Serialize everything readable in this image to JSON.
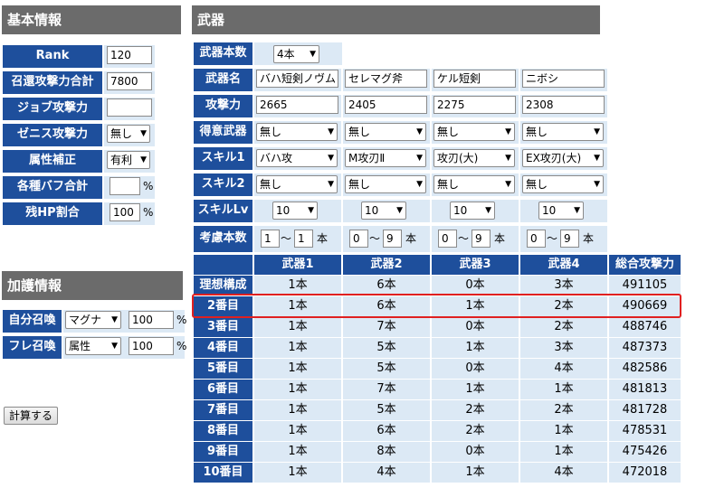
{
  "basic": {
    "header": "基本情報",
    "rows": [
      {
        "label": "Rank",
        "type": "input",
        "value": "120"
      },
      {
        "label": "召還攻撃力合計",
        "type": "input",
        "value": "7800"
      },
      {
        "label": "ジョブ攻撃力",
        "type": "input",
        "value": ""
      },
      {
        "label": "ゼニス攻撃力",
        "type": "select",
        "value": "無し"
      },
      {
        "label": "属性補正",
        "type": "select",
        "value": "有利"
      },
      {
        "label": "各種バフ合計",
        "type": "input_unit",
        "value": "",
        "unit": "%"
      },
      {
        "label": "残HP割合",
        "type": "input_unit",
        "value": "100",
        "unit": "%"
      }
    ]
  },
  "kago": {
    "header": "加護情報",
    "rows": [
      {
        "label": "自分召喚",
        "select": "マグナ",
        "value": "100",
        "unit": "%"
      },
      {
        "label": "フレ召喚",
        "select": "属性",
        "value": "100",
        "unit": "%"
      }
    ]
  },
  "calc_button": "計算する",
  "weapons": {
    "header": "武器",
    "count_label": "武器本数",
    "count_value": "4本",
    "name_label": "武器名",
    "names": [
      "バハ短剣ノヴム",
      "セレマグ斧",
      "ケル短剣",
      "ニボシ"
    ],
    "atk_label": "攻撃力",
    "atks": [
      "2665",
      "2405",
      "2275",
      "2308"
    ],
    "type_label": "得意武器",
    "types": [
      "無し",
      "無し",
      "無し",
      "無し"
    ],
    "skill1_label": "スキル1",
    "skill1": [
      "バハ攻",
      "M攻刃Ⅱ",
      "攻刃(大)",
      "EX攻刃(大)"
    ],
    "skill2_label": "スキル2",
    "skill2": [
      "無し",
      "無し",
      "無し",
      "無し"
    ],
    "skilllv_label": "スキルLv",
    "skilllv": [
      "10",
      "10",
      "10",
      "10"
    ],
    "range_label": "考慮本数",
    "tilde": "～",
    "hon": "本",
    "ranges": [
      {
        "min": "1",
        "max": "1"
      },
      {
        "min": "0",
        "max": "9"
      },
      {
        "min": "0",
        "max": "9"
      },
      {
        "min": "0",
        "max": "9"
      }
    ]
  },
  "results": {
    "headers": [
      "武器1",
      "武器2",
      "武器3",
      "武器4",
      "総合攻撃力"
    ],
    "rows": [
      {
        "label": "理想構成",
        "cells": [
          "1本",
          "6本",
          "0本",
          "3本",
          "491105"
        ]
      },
      {
        "label": "2番目",
        "cells": [
          "1本",
          "6本",
          "1本",
          "2本",
          "490669"
        ]
      },
      {
        "label": "3番目",
        "cells": [
          "1本",
          "7本",
          "0本",
          "2本",
          "488746"
        ]
      },
      {
        "label": "4番目",
        "cells": [
          "1本",
          "5本",
          "1本",
          "3本",
          "487373"
        ]
      },
      {
        "label": "5番目",
        "cells": [
          "1本",
          "5本",
          "0本",
          "4本",
          "482586"
        ]
      },
      {
        "label": "6番目",
        "cells": [
          "1本",
          "7本",
          "1本",
          "1本",
          "481813"
        ]
      },
      {
        "label": "7番目",
        "cells": [
          "1本",
          "5本",
          "2本",
          "2本",
          "481728"
        ]
      },
      {
        "label": "8番目",
        "cells": [
          "1本",
          "6本",
          "2本",
          "1本",
          "478531"
        ]
      },
      {
        "label": "9番目",
        "cells": [
          "1本",
          "8本",
          "0本",
          "1本",
          "475426"
        ]
      },
      {
        "label": "10番目",
        "cells": [
          "1本",
          "4本",
          "1本",
          "4本",
          "472018"
        ]
      }
    ]
  }
}
